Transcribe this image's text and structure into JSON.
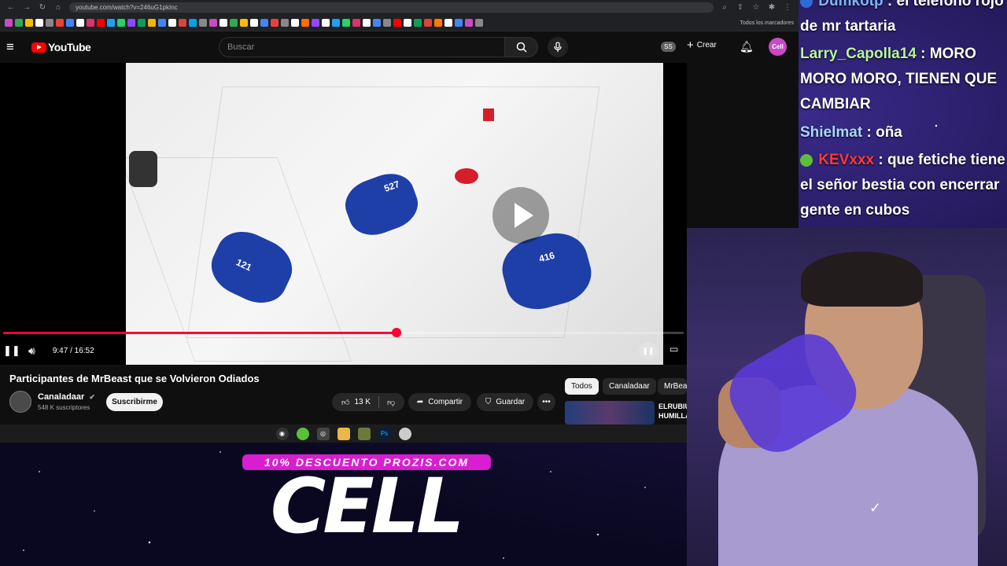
{
  "browser": {
    "url": "youtube.com/watch?v=246uG1pkInc",
    "bookmarks_folder": "Todos los marcadores"
  },
  "youtube": {
    "logo_text": "YouTube",
    "search_placeholder": "Buscar",
    "ss_badge": "SS",
    "create_label": "Crear",
    "avatar_text": "Cell"
  },
  "player": {
    "time_display": "9:47 / 16:52",
    "progress_fraction": 0.578,
    "jersey_numbers": [
      "527",
      "121",
      "416"
    ]
  },
  "video": {
    "title": "Participantes de MrBeast que se Volvieron Odiados",
    "channel_name": "Canaladaar",
    "subscribers": "548 K suscriptores",
    "subscribe_label": "Suscribirme",
    "likes": "13 K",
    "share_label": "Compartir",
    "save_label": "Guardar"
  },
  "sidebar": {
    "chips": [
      "Todos",
      "Canaladaar",
      "MrBeast"
    ],
    "rec_title_lines": [
      "ELRUBIU",
      "HUMILLA"
    ]
  },
  "promo": {
    "banner": "10% DESCUENTO PROZIS.COM",
    "logo": "CELL"
  },
  "chat": [
    {
      "user": "Dumkotp",
      "text": "el teléfono rojo de mr tartaria",
      "color": "#7fb3ff"
    },
    {
      "user": "Larry_Capolla14",
      "text": "MORO MORO MORO, TIENEN QUE CAMBIAR",
      "color": "#b8f5a0"
    },
    {
      "user": "Shielmat",
      "text": "oña",
      "color": "#a8d8ff"
    },
    {
      "user": "KEVxxx",
      "text": "que fetiche tiene el señor bestia con encerrar gente en cubos",
      "color": "#ff3b3b"
    }
  ],
  "colors": {
    "yt_red": "#ff0000",
    "progress_red": "#ff0033",
    "promo_magenta": "#d81ed0"
  }
}
